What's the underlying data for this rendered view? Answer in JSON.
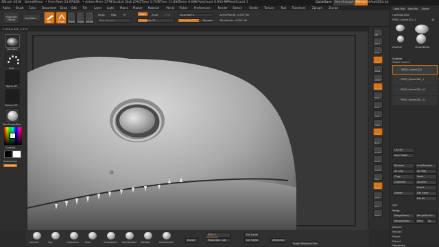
{
  "titlebar": {
    "app": "ZBrush 2018",
    "doc": "DemoRhino",
    "free_mem": "• Free Mem 23.974GB",
    "active_mem": "• Active Mem 1774",
    "scratch": "• Scratch Disk 274",
    "ztime": "• ZTime 1.717",
    "rtime": "• RTime 11.812",
    "timer": "• Timer 0.000",
    "polycount": "• PolyCount 0.933 MP",
    "meshcount": "• MeshCount 1",
    "quicksave": "QuickSave",
    "see_through": "See-through 0",
    "menus": "Menus",
    "script": "DefaultZScript"
  },
  "menubar": [
    "Alpha",
    "Brush",
    "Color",
    "Document",
    "Draw",
    "Edit",
    "File",
    "Layer",
    "Light",
    "Macro",
    "Marker",
    "Material",
    "Movie",
    "Picker",
    "Preferences",
    "Render",
    "Stencil",
    "Stroke",
    "Texture",
    "Tool",
    "Transform",
    "Zplugin",
    "Zscript"
  ],
  "toolbar": {
    "projection_master": "Projection Master",
    "lightbox": "LightBox",
    "edit": "Edit",
    "draw": "Draw",
    "move": "Move",
    "scale": "Scale",
    "rotate": "Rotate",
    "mrgb": "Mrgb",
    "rgb": "Rgb",
    "m": "M",
    "rgb_intensity": "Rgb Intensity",
    "zadd": "Zadd",
    "zsub": "Zsub",
    "zcut": "Zcut",
    "z_intensity": "Z Intensity 25",
    "focal_shift": "Focal Shift 0",
    "draw_size": "Draw Size 274",
    "dynamic": "Dynamic",
    "active_points": "ActivePoints: 4,555 Mil",
    "total_points": "TotalPoints: 4,554 Mil"
  },
  "infobar": {
    "coords": "0.038,0.021,-7.174"
  },
  "leftshelf": {
    "standard": "Standard",
    "dots": "Dots",
    "alpha_off": "Alpha Off",
    "texture_off": "Texture Off",
    "material": "SkinShade4Mat",
    "gradient": "Gradient",
    "switch_color": "SwitchColor",
    "alternate": "Alternate"
  },
  "rightshelf": [
    "BPR",
    "SPix 3",
    "Scroll",
    "Zoom",
    "Actual",
    "AAHalf",
    "Dynamic",
    "Persp",
    "Floor",
    "Local",
    "L.Sym",
    "Frame",
    "Move",
    "ZoomD",
    "Rotate",
    "Line Fill",
    "PolyF",
    "Transp",
    "Ghost",
    "Solo",
    "Xpose"
  ],
  "tray": {
    "header": [
      "Load Tool",
      "Save As",
      "Copy Tool",
      "Paste Tool",
      "Import",
      "Export",
      "Clone",
      "Make PolyMesh3D",
      "GoZ",
      "All",
      "Visible",
      "R"
    ],
    "lightbox_tools": "Lightbox▸Tools",
    "current_tool": "PM3D_Sphere3D1_1",
    "current_count": "48",
    "tool_thumbs": [
      "PM3D_Sphere3D1",
      "Sphere3D",
      "ZSphere",
      "SimpleBrush"
    ],
    "subtool": "Subtool",
    "visible_count": "Visible Count 4",
    "subtools": [
      "PM3D_Sphere3D1",
      "PM3D_Sphere3D1_1",
      "PM3D_Sphere3D1_12",
      "PM3D_Sphere3D1_12"
    ],
    "list_all": "List All",
    "new_folder": "New Folder",
    "rename": "Rename",
    "autoreorder": "AutoReorder",
    "all_low": "All Low",
    "all_high": "All High",
    "copy": "Copy",
    "paste": "Paste",
    "duplicate": "Duplicate",
    "append": "Append",
    "insert": "Insert",
    "del_other": "Del Other",
    "delete": "Delete",
    "del_all": "Del All",
    "split": "Split",
    "merge": "Merge",
    "merge_down": "MergeDown",
    "merge_similar": "MergeSimilar",
    "merge_visible": "MergeVisible",
    "weld": "Weld",
    "uv": "Uv",
    "boolean": "Boolean",
    "remesh": "Remesh",
    "project": "Project",
    "extract": "Extract",
    "geometry": "Geometry"
  },
  "bottomshelf": {
    "brushes": [
      "Standard",
      "Clay",
      "ClayBuildup",
      "Move",
      "TrimAdaptive",
      "DamStandard",
      "ZModeler",
      "DamStandard"
    ],
    "divide": "Divide",
    "sdiv": "SDiv 4",
    "del_lower": "Del Lower",
    "del_higher": "Del Higher",
    "dynamesh": "Resolution 128",
    "zremesher": "ZRemesher",
    "target_count": "Target Polygons Count 2"
  },
  "colors": {
    "accent": "#d4761d",
    "bg": "#2a2a2a"
  }
}
